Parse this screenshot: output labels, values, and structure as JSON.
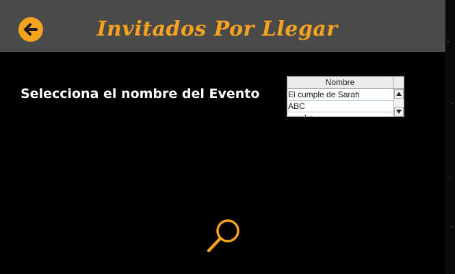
{
  "window": {
    "title": "Invitados Por Llegar"
  },
  "header": {
    "back_icon": "arrow-left-circle-icon"
  },
  "main": {
    "prompt": "Selecciona el nombre del Evento",
    "table": {
      "column_header": "Nombre",
      "rows": [
        {
          "name": "El cumple de Sarah"
        },
        {
          "name": "ABC"
        },
        {
          "name": "prueba"
        }
      ]
    },
    "search_icon": "search-icon"
  },
  "colors": {
    "accent": "#f6a21e",
    "header_bg": "#4a4a4a",
    "background": "#000000"
  }
}
